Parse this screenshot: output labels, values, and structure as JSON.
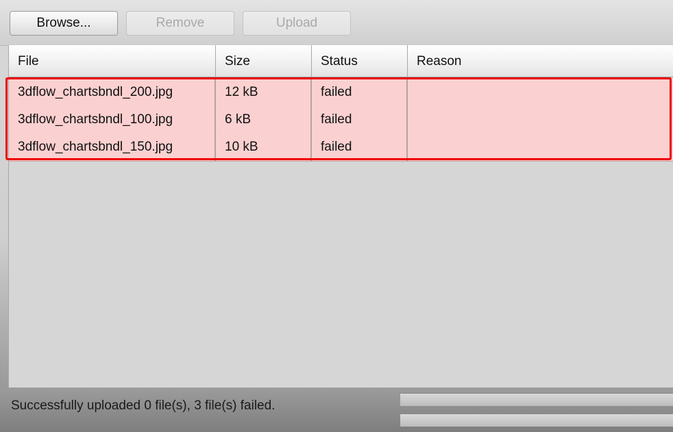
{
  "toolbar": {
    "browse_label": "Browse...",
    "remove_label": "Remove",
    "upload_label": "Upload"
  },
  "table": {
    "columns": [
      "File",
      "Size",
      "Status",
      "Reason"
    ],
    "rows": [
      {
        "file": "3dflow_chartsbndl_200.jpg",
        "size": "12 kB",
        "status": "failed",
        "reason": ""
      },
      {
        "file": "3dflow_chartsbndl_100.jpg",
        "size": "6 kB",
        "status": "failed",
        "reason": ""
      },
      {
        "file": "3dflow_chartsbndl_150.jpg",
        "size": "10 kB",
        "status": "failed",
        "reason": ""
      }
    ]
  },
  "status": {
    "message": "Successfully uploaded 0 file(s), 3 file(s) failed.",
    "file_progress": 0,
    "total_progress": 0
  },
  "colors": {
    "failed_row": "#fbd0d0",
    "highlight_border": "#ee0000"
  }
}
